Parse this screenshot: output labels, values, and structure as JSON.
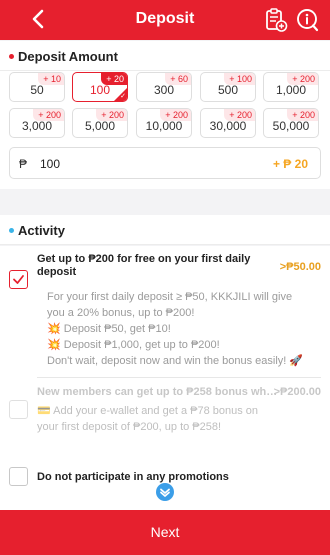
{
  "header": {
    "title": "Deposit"
  },
  "deposit": {
    "heading": "Deposit Amount",
    "options": [
      {
        "value": "50",
        "bonus": "+ 10",
        "selected": false
      },
      {
        "value": "100",
        "bonus": "+ 20",
        "selected": true
      },
      {
        "value": "300",
        "bonus": "+ 60",
        "selected": false
      },
      {
        "value": "500",
        "bonus": "+ 100",
        "selected": false
      },
      {
        "value": "1,000",
        "bonus": "+ 200",
        "selected": false
      },
      {
        "value": "3,000",
        "bonus": "+ 200",
        "selected": false
      },
      {
        "value": "5,000",
        "bonus": "+ 200",
        "selected": false
      },
      {
        "value": "10,000",
        "bonus": "+ 200",
        "selected": false
      },
      {
        "value": "30,000",
        "bonus": "+ 200",
        "selected": false
      },
      {
        "value": "50,000",
        "bonus": "+ 200",
        "selected": false
      }
    ],
    "currency_symbol": "₱",
    "amount_value": "100",
    "extra_bonus": "+ ₱ 20"
  },
  "activity": {
    "heading": "Activity",
    "promos": [
      {
        "title": "Get up to ₱200 for free on your first daily deposit",
        "amount": ">₱50.00",
        "checked": true,
        "lines": [
          "For your first daily deposit ≥ ₱50, KKKJILI will give",
          "you a 20% bonus, up to ₱200!",
          "💥 Deposit ₱50, get ₱10!",
          "💥 Deposit ₱1,000, get up to ₱200!",
          "Don't wait, deposit now and win the bonus easily! 🚀"
        ]
      },
      {
        "title": "New members can get up to ₱258 bonus wh…",
        "amount": ">₱200.00",
        "checked": false,
        "lines": [
          "💳 Add your e-wallet and get a ₱78 bonus on",
          "your first deposit of ₱200, up to ₱258!"
        ]
      }
    ],
    "no_promo_label": "Do not participate in any promotions"
  },
  "footer": {
    "next_label": "Next"
  },
  "colors": {
    "brand": "#e6202e",
    "accent_orange": "#f5a623",
    "activity_dot": "#3ab4e8"
  }
}
